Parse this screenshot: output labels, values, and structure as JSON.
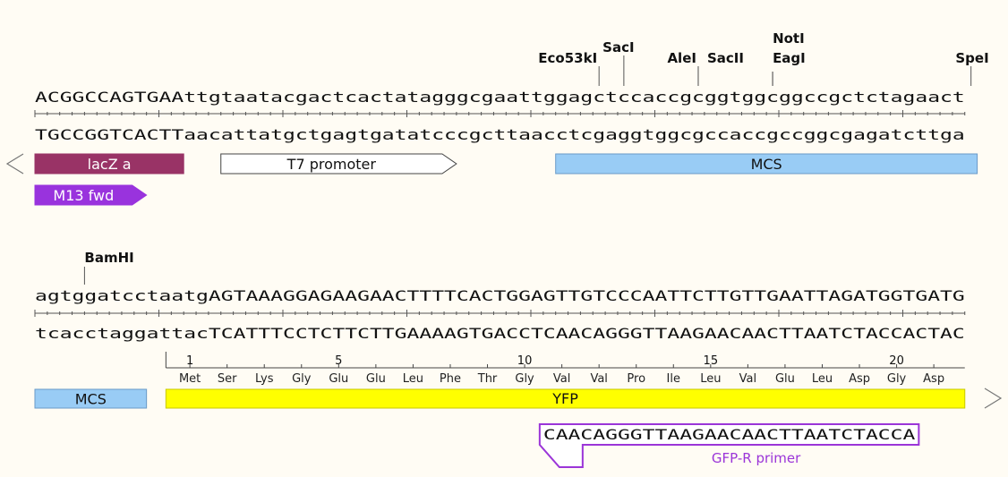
{
  "colors": {
    "background": "#fffcf4",
    "lacz": "#993366",
    "m13": "#9933dd",
    "mcs": "#99ccf5",
    "yfp": "#ffff00",
    "primer": "#9b35d8",
    "ruler": "#555555"
  },
  "row1": {
    "top": "ACGGCCAGTGAAttgtaatacgactcactatagggcgaattggagctccaccgcggtggcggccgctctagaact",
    "bottom": "TGCCGGTCACTTaacattatgctgagtgatatcccgcttaacctcgaggtggcgccaccgccggcgagatcttga",
    "enzymes": [
      {
        "name": "Eco53kI",
        "pos": 45.5
      },
      {
        "name": "SacI",
        "pos": 47.5
      },
      {
        "name": "AleI",
        "pos": 53.5
      },
      {
        "name": "SacII",
        "pos": 53.5
      },
      {
        "name": "NotI",
        "pos": 59.5
      },
      {
        "name": "EagI",
        "pos": 59.5
      },
      {
        "name": "SpeI",
        "pos": 75.5
      }
    ],
    "features": [
      {
        "name": "lacZ a",
        "start": 0,
        "end": 12,
        "kind": "lacz",
        "dir": "left"
      },
      {
        "name": "T7 promoter",
        "start": 15,
        "end": 34,
        "kind": "promoter",
        "dir": "right"
      },
      {
        "name": "MCS",
        "start": 42,
        "end": 76,
        "kind": "mcs",
        "dir": "none"
      },
      {
        "name": "M13 fwd",
        "start": 0,
        "end": 9,
        "kind": "m13",
        "dir": "right"
      }
    ]
  },
  "row2": {
    "top": "agtggatcctaatgAGTAAAGGAGAAGAACTTTTCACTGGAGTTGTCCCAATTCTTGTTGAATTAGATGGTGATG",
    "bottom": "tcacctaggattacTCATTTCCTCTTCTTGAAAAGTGACCTCAACAGGGTTAAGAACAACTTAATCTACCACTAC",
    "enzymes": [
      {
        "name": "BamHI",
        "pos": 4
      }
    ],
    "translation": {
      "start": 11,
      "numbers": [
        "1",
        "5",
        "10",
        "15",
        "20"
      ],
      "number_codons": [
        0,
        4,
        9,
        14,
        19
      ],
      "aminoacids": [
        "Met",
        "Ser",
        "Lys",
        "Gly",
        "Glu",
        "Glu",
        "Leu",
        "Phe",
        "Thr",
        "Gly",
        "Val",
        "Val",
        "Pro",
        "Ile",
        "Leu",
        "Val",
        "Glu",
        "Leu",
        "Asp",
        "Gly",
        "Asp"
      ]
    },
    "features": [
      {
        "name": "MCS",
        "start": 0,
        "end": 9,
        "kind": "mcs",
        "dir": "none"
      },
      {
        "name": "YFP",
        "start": 11,
        "end": 76,
        "kind": "yfp",
        "dir": "right"
      }
    ],
    "primer": {
      "sequence": "CAACAGGGTTAAGAACAACTTAATCTACCA",
      "label": "GFP-R primer",
      "start": 41
    }
  }
}
